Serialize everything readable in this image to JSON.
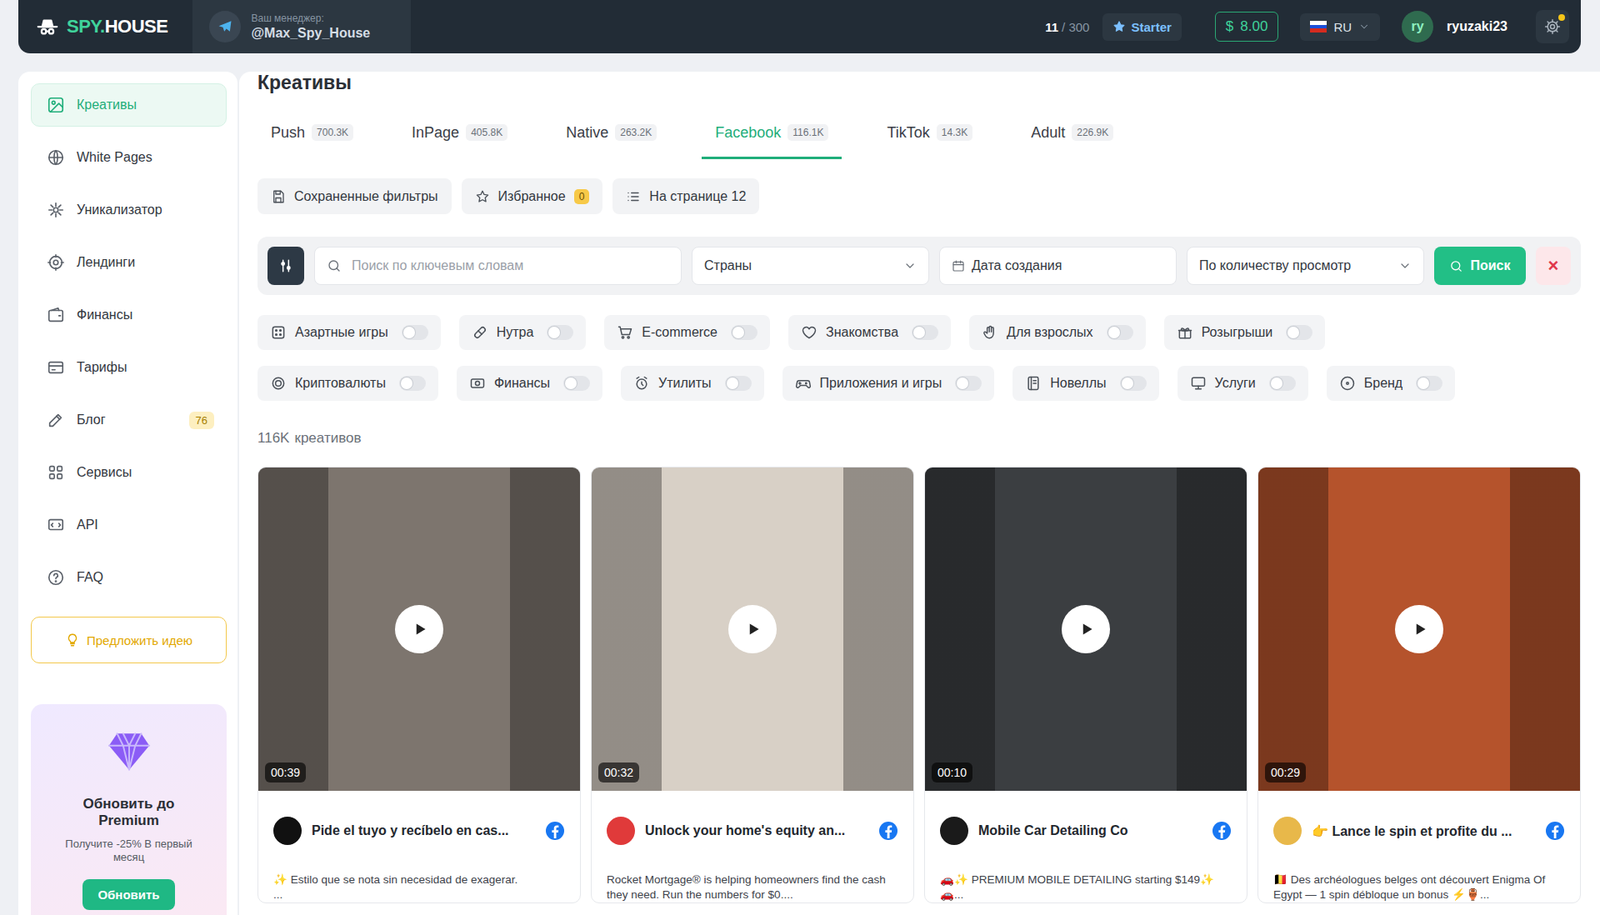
{
  "header": {
    "logo": {
      "accent": "SPY.",
      "rest": "HOUSE"
    },
    "manager": {
      "label": "Ваш менеджер:",
      "handle": "@Max_Spy_House"
    },
    "quota": {
      "used": "11",
      "total": "/ 300"
    },
    "plan": "Starter",
    "balance": {
      "currency": "$",
      "amount": "8.00"
    },
    "language": "RU",
    "user": {
      "initials": "ry",
      "name": "ryuzaki23"
    },
    "settings": {
      "has_notification": true
    }
  },
  "sidebar": {
    "items": [
      {
        "label": "Креативы",
        "selected": true
      },
      {
        "label": "White Pages",
        "selected": false
      },
      {
        "label": "Уникализатор",
        "selected": false
      },
      {
        "label": "Лендинги",
        "selected": false
      },
      {
        "label": "Финансы",
        "selected": false
      },
      {
        "label": "Тарифы",
        "selected": false
      },
      {
        "label": "Блог",
        "selected": false,
        "badge": "76"
      },
      {
        "label": "Сервисы",
        "selected": false
      },
      {
        "label": "API",
        "selected": false
      },
      {
        "label": "FAQ",
        "selected": false
      }
    ],
    "suggest_button": "Предложить идею",
    "promo": {
      "title": "Обновить до Premium",
      "text": "Получите -25% В первый месяц",
      "button": "Обновить"
    }
  },
  "main": {
    "title": "Креативы",
    "tabs": [
      {
        "label": "Push",
        "count": "700.3K",
        "selected": false
      },
      {
        "label": "InPage",
        "count": "405.8K",
        "selected": false
      },
      {
        "label": "Native",
        "count": "263.2K",
        "selected": false
      },
      {
        "label": "Facebook",
        "count": "116.1K",
        "selected": true
      },
      {
        "label": "TikTok",
        "count": "14.3K",
        "selected": false
      },
      {
        "label": "Adult",
        "count": "226.9K",
        "selected": false
      }
    ],
    "toolbar": [
      {
        "label": "Сохраненные фильтры"
      },
      {
        "label": "Избранное",
        "badge": "0"
      },
      {
        "label": "На странице 12"
      }
    ],
    "filters": {
      "search_placeholder": "Поиск по ключевым словам",
      "countries": "Страны",
      "date": "Дата создания",
      "sort": "По количеству просмотр",
      "search_button": "Поиск",
      "clear_button": "×"
    },
    "category_rows": [
      [
        {
          "label": "Азартные игры",
          "on": false
        },
        {
          "label": "Нутра",
          "on": false
        },
        {
          "label": "E-commerce",
          "on": false
        },
        {
          "label": "Знакомства",
          "on": false
        },
        {
          "label": "Для взрослых",
          "on": false
        },
        {
          "label": "Розыгрыши",
          "on": false
        }
      ],
      [
        {
          "label": "Криптовалюты",
          "on": false
        },
        {
          "label": "Финансы",
          "on": false
        },
        {
          "label": "Утилиты",
          "on": false
        },
        {
          "label": "Приложения и игры",
          "on": false
        },
        {
          "label": "Новеллы",
          "on": false
        },
        {
          "label": "Услуги",
          "on": false
        },
        {
          "label": "Бренд",
          "on": false
        }
      ]
    ],
    "results": {
      "count": "116K",
      "label": "креативов"
    },
    "cards": [
      {
        "duration": "00:39",
        "title": "Pide el tuyo y recíbelo en cas...",
        "description": "✨ Estilo que se nota sin necesidad de exagerar.\n...",
        "color": "#7d756e",
        "avatar_color": "#111111"
      },
      {
        "duration": "00:32",
        "title": "Unlock your home's equity an...",
        "description": "Rocket Mortgage® is helping homeowners find the cash they need. Run the numbers for $0....",
        "color": "#d8d0c6",
        "avatar_color": "#e03a3a"
      },
      {
        "duration": "00:10",
        "title": "Mobile Car Detailing Co",
        "description": "🚗✨ PREMIUM MOBILE DETAILING starting $149✨\n🚗...",
        "color": "#3b3e41",
        "avatar_color": "#1a1a1a"
      },
      {
        "duration": "00:29",
        "title": "👉 Lance le spin et profite du ...",
        "description": "🇧🇪 Des archéologues belges ont découvert Enigma Of Egypt — 1 spin débloque un bonus ⚡🏺...",
        "color": "#b5532c",
        "avatar_color": "#e8b84a"
      }
    ]
  }
}
